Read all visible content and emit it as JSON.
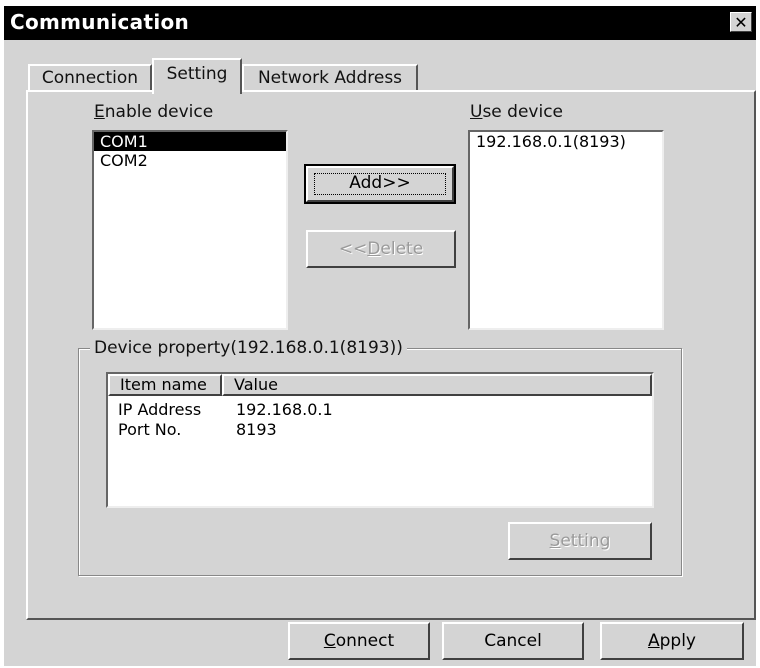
{
  "window": {
    "title": "Communication",
    "close_glyph": "✕"
  },
  "tabs": [
    {
      "label": "Connection",
      "active": false
    },
    {
      "label": "Setting",
      "active": true
    },
    {
      "label": "Network Address",
      "active": false
    }
  ],
  "enable_device": {
    "label_underlined": "E",
    "label_rest": "nable device",
    "items": [
      "COM1",
      "COM2"
    ],
    "selected_index": 0
  },
  "use_device": {
    "label_underlined": "U",
    "label_rest": "se device",
    "items": [
      "192.168.0.1(8193)"
    ]
  },
  "buttons": {
    "add": "Add>>",
    "delete_prefix": "<<",
    "delete_underlined": "D",
    "delete_rest": "elete",
    "setting_underlined": "S",
    "setting_rest": "etting",
    "connect_underlined": "C",
    "connect_rest": "onnect",
    "cancel": "Cancel",
    "apply_underlined": "A",
    "apply_rest": "pply"
  },
  "device_property": {
    "title": "Device property(192.168.0.1(8193))",
    "columns": [
      "Item name",
      "Value"
    ],
    "rows": [
      {
        "name": "IP Address",
        "value": "192.168.0.1"
      },
      {
        "name": "Port No.",
        "value": "8193"
      }
    ]
  }
}
